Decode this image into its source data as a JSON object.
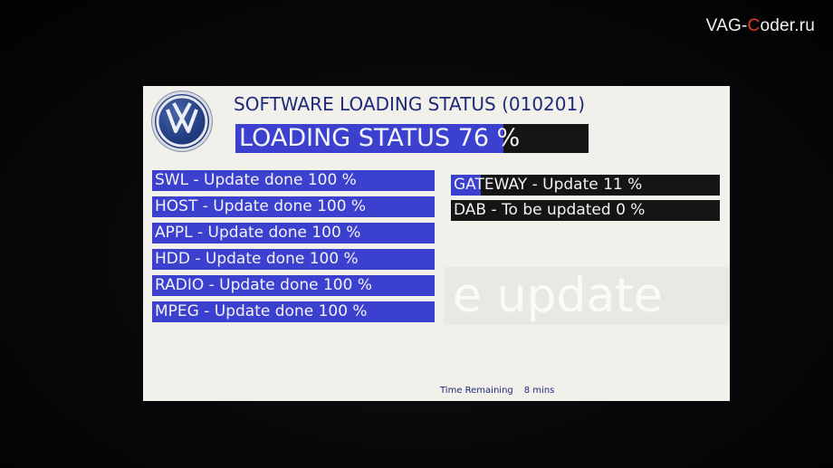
{
  "watermark": {
    "prefix": "VAG-",
    "accent": "C",
    "suffix": "oder.ru"
  },
  "header": {
    "logo": "volkswagen-logo",
    "title": "SOFTWARE LOADING STATUS (010201)"
  },
  "overall": {
    "text": "LOADING STATUS 76 %",
    "progress": 0.76
  },
  "modules_left": [
    {
      "label": "SWL - Update done 100 %",
      "progress": 1.0
    },
    {
      "label": "HOST - Update done 100 %",
      "progress": 1.0
    },
    {
      "label": "APPL - Update done 100 %",
      "progress": 1.0
    },
    {
      "label": "HDD - Update done 100 %",
      "progress": 1.0
    },
    {
      "label": "RADIO - Update done 100 %",
      "progress": 1.0
    },
    {
      "label": "MPEG - Update done 100 %",
      "progress": 1.0
    }
  ],
  "modules_right": [
    {
      "label": "GATEWAY - Update 11 %",
      "progress": 0.11
    },
    {
      "label": "DAB - To be updated 0 %",
      "progress": 0.0
    }
  ],
  "background_text": "e update",
  "footer": {
    "time_label": "Time Remaining",
    "time_value": "8 mins"
  },
  "colors": {
    "screen_bg": "#f1f0ea",
    "progress_fill": "#3b40cf",
    "bar_bg": "#151515",
    "title_text": "#1f2a78",
    "watermark_accent": "#e23a2a"
  }
}
